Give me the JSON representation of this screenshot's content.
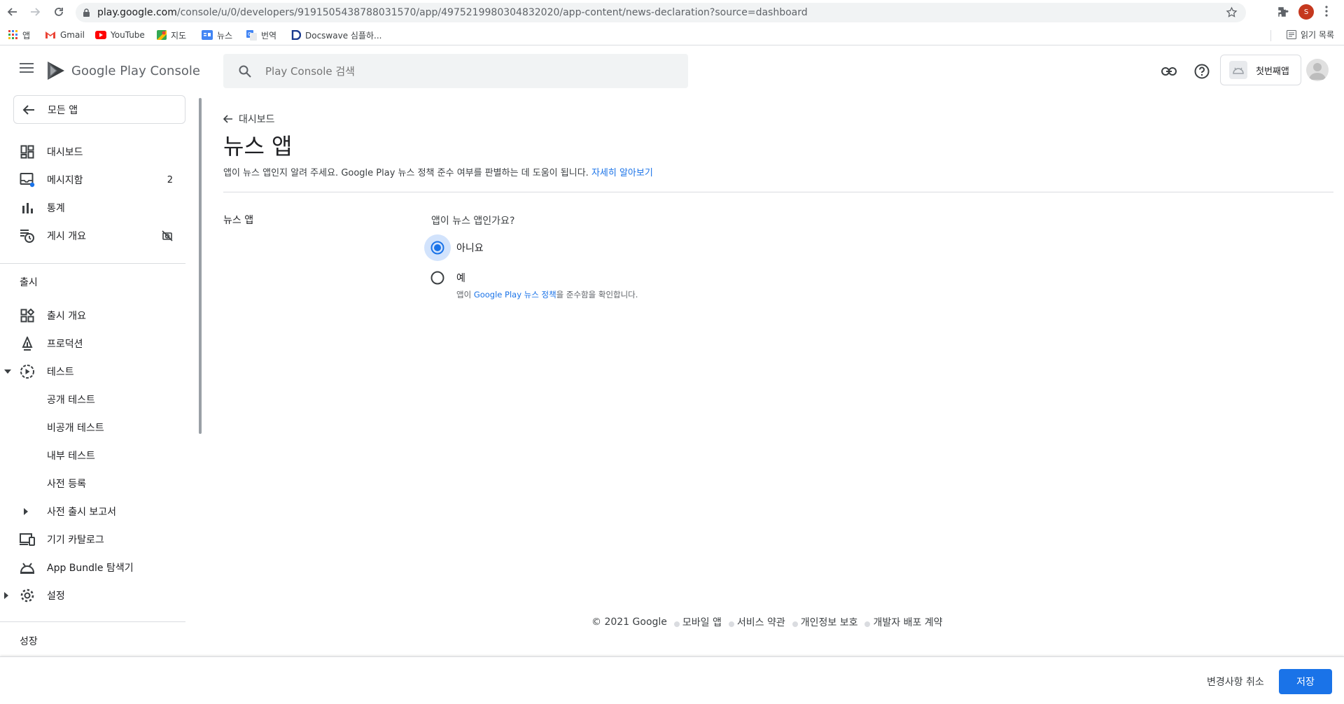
{
  "browser": {
    "url_host": "play.google.com",
    "url_path": "/console/u/0/developers/9191505438788031570/app/4975219980304832020/app-content/news-declaration?source=dashboard",
    "profile_initial": "S",
    "bookmarks": [
      {
        "label": "앱",
        "icon": "apps-grid-icon"
      },
      {
        "label": "Gmail",
        "icon": "gmail-icon"
      },
      {
        "label": "YouTube",
        "icon": "youtube-icon"
      },
      {
        "label": "지도",
        "icon": "maps-icon"
      },
      {
        "label": "뉴스",
        "icon": "news-icon"
      },
      {
        "label": "번역",
        "icon": "translate-icon"
      },
      {
        "label": "Docswave 심플하...",
        "icon": "docswave-icon"
      }
    ],
    "reading_list": "읽기 목록"
  },
  "header": {
    "logo_text_google_play": "Google Play",
    "logo_text_console": "Console",
    "search_placeholder": "Play Console 검색",
    "app_name": "첫번째앱"
  },
  "sidebar": {
    "back_label": "모든 앱",
    "items": [
      {
        "label": "대시보드",
        "icon": "dashboard-icon"
      },
      {
        "label": "메시지함",
        "icon": "inbox-icon",
        "badge": "2"
      },
      {
        "label": "통계",
        "icon": "bar-chart-icon"
      },
      {
        "label": "게시 개요",
        "icon": "publishing-overview-icon"
      }
    ],
    "release_section": "출시",
    "release_items": [
      {
        "label": "출시 개요",
        "icon": "release-overview-icon"
      },
      {
        "label": "프로덕션",
        "icon": "production-icon"
      },
      {
        "label": "테스트",
        "icon": "testing-icon"
      },
      {
        "label": "공개 테스트"
      },
      {
        "label": "비공개 테스트"
      },
      {
        "label": "내부 테스트"
      },
      {
        "label": "사전 등록"
      },
      {
        "label": "사전 출시 보고서"
      },
      {
        "label": "기기 카탈로그",
        "icon": "device-catalog-icon"
      },
      {
        "label": "App Bundle 탐색기",
        "icon": "app-bundle-explorer-icon"
      },
      {
        "label": "설정",
        "icon": "settings-icon"
      }
    ],
    "growth_section": "성장"
  },
  "main": {
    "breadcrumb": "대시보드",
    "title": "뉴스 앱",
    "description": "앱이 뉴스 앱인지 알려 주세요. Google Play 뉴스 정책 준수 여부를 판별하는 데 도움이 됩니다.",
    "learn_more": "자세히 알아보기",
    "field_label": "뉴스 앱",
    "question": "앱이 뉴스 앱인가요?",
    "option_no": "아니요",
    "option_yes": "예",
    "yes_sub_prefix": "앱이 ",
    "yes_sub_link": "Google Play 뉴스 정책",
    "yes_sub_suffix": "을 준수함을 확인합니다.",
    "selected": "no"
  },
  "footer": {
    "copyright": "© 2021 Google",
    "links": [
      "모바일 앱",
      "서비스 약관",
      "개인정보 보호",
      "개발자 배포 계약"
    ]
  },
  "bottom_bar": {
    "discard_label": "변경사항 취소",
    "save_label": "저장"
  },
  "colors": {
    "accent": "#1a73e8",
    "radio_halo": "#d2e3fc",
    "profile": "#c5381e"
  }
}
